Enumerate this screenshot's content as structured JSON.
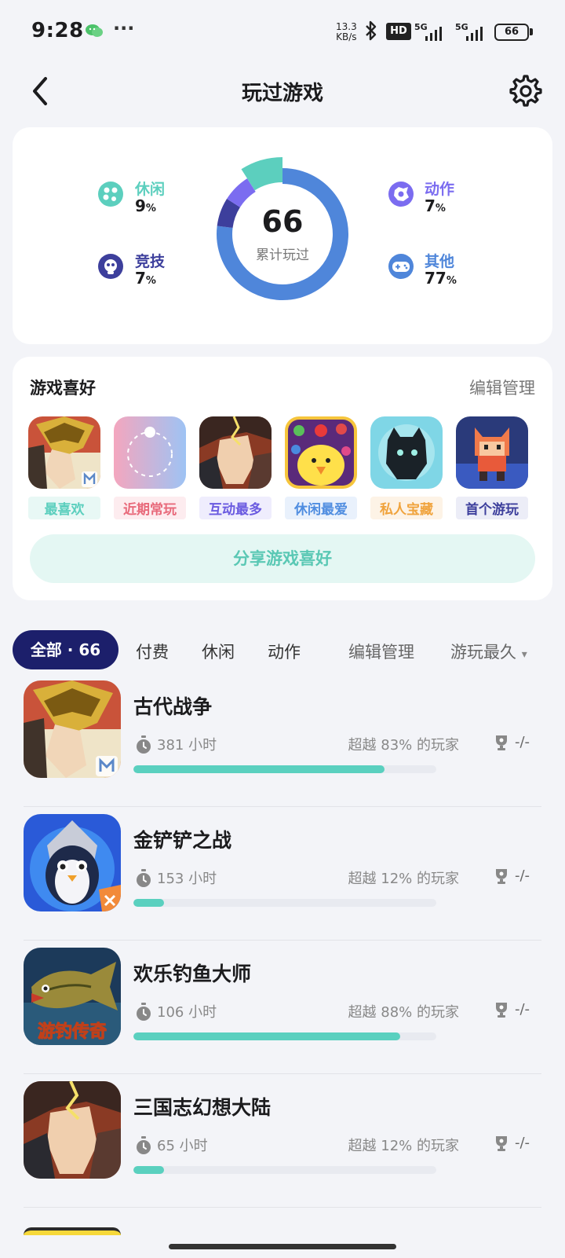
{
  "status_bar": {
    "time": "9:28",
    "dots": "···",
    "net_speed_value": "13.3",
    "net_speed_unit": "KB/s",
    "hd": "HD",
    "sig1": "5G",
    "sig2": "5G",
    "battery": "66"
  },
  "header": {
    "title": "玩过游戏"
  },
  "summary": {
    "total": "66",
    "total_label": "累计玩过",
    "categories": [
      {
        "name": "休闲",
        "pct": "9",
        "unit": "%",
        "color": "#5ccfbe",
        "icon": "casual-icon"
      },
      {
        "name": "竞技",
        "pct": "7",
        "unit": "%",
        "color": "#3d3f9c",
        "icon": "competitive-icon"
      },
      {
        "name": "动作",
        "pct": "7",
        "unit": "%",
        "color": "#7b6cf0",
        "icon": "action-icon"
      },
      {
        "name": "其他",
        "pct": "77",
        "unit": "%",
        "color": "#4f86da",
        "icon": "gamepad-icon"
      }
    ]
  },
  "preferences": {
    "title": "游戏喜好",
    "edit": "编辑管理",
    "items": [
      {
        "label": "最喜欢",
        "color": "#5ccfbe",
        "bg": "#e8f8f5"
      },
      {
        "label": "近期常玩",
        "color": "#e8697a",
        "bg": "#fdecef"
      },
      {
        "label": "互动最多",
        "color": "#6a5ae0",
        "bg": "#efedfd"
      },
      {
        "label": "休闲最爱",
        "color": "#4f8de0",
        "bg": "#e9f1fc"
      },
      {
        "label": "私人宝藏",
        "color": "#f0a33c",
        "bg": "#fdf3e6"
      },
      {
        "label": "首个游玩",
        "color": "#3d3f9c",
        "bg": "#ecedf7"
      }
    ],
    "share": "分享游戏喜好"
  },
  "tabs": {
    "all": "全部 · 66",
    "paid": "付费",
    "casual": "休闲",
    "action": "动作",
    "edit": "编辑管理",
    "sort": "游玩最久",
    "sort_arrow": "▾"
  },
  "games": [
    {
      "name": "古代战争",
      "hours": "381 小时",
      "beat": "超越 83% 的玩家",
      "progress": 0.83,
      "rank": "-/-",
      "overlay": ""
    },
    {
      "name": "金铲铲之战",
      "hours": "153 小时",
      "beat": "超越 12% 的玩家",
      "progress": 0.1,
      "rank": "-/-",
      "overlay": ""
    },
    {
      "name": "欢乐钓鱼大师",
      "hours": "106 小时",
      "beat": "超越 88% 的玩家",
      "progress": 0.88,
      "rank": "-/-",
      "overlay": "游钓传奇"
    },
    {
      "name": "三国志幻想大陆",
      "hours": "65 小时",
      "beat": "超越 12% 的玩家",
      "progress": 0.1,
      "rank": "-/-",
      "overlay": ""
    }
  ]
}
